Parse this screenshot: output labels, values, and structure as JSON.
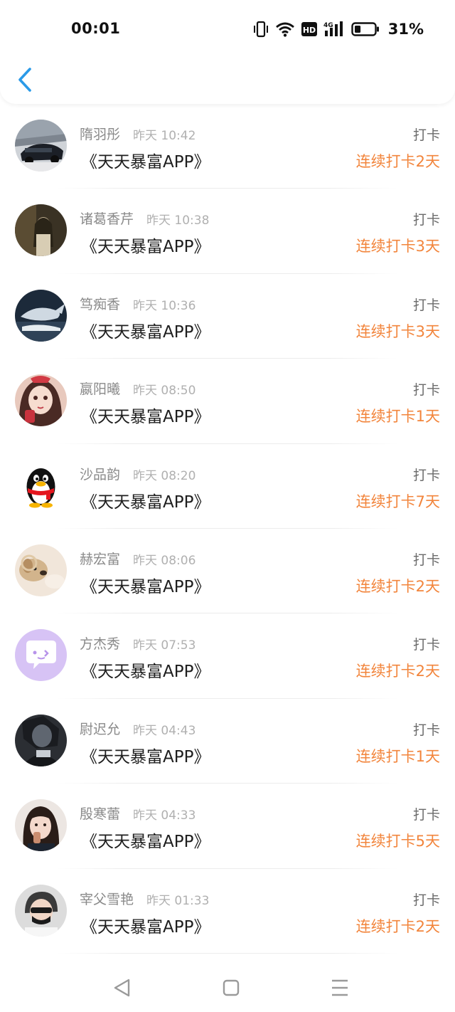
{
  "status_bar": {
    "time": "00:01",
    "battery_percent": "31%",
    "battery_level": 0.31,
    "network_label": "4G",
    "hd_label": "HD",
    "icons": [
      "vibrate-icon",
      "wifi-icon",
      "hd-icon",
      "signal-4g-icon",
      "battery-icon"
    ]
  },
  "header": {
    "back_icon": "chevron-left-icon"
  },
  "colors": {
    "accent_back": "#2a9ae8",
    "streak": "#f2853c",
    "name": "#8a8a8a",
    "time": "#b0b0b0"
  },
  "list": [
    {
      "name": "隋羽彤",
      "time": "昨天 10:42",
      "title": "《天天暴富APP》",
      "action": "打卡",
      "streak": "连续打卡2天",
      "avatar": "car-photo"
    },
    {
      "name": "诸葛香芹",
      "time": "昨天 10:38",
      "title": "《天天暴富APP》",
      "action": "打卡",
      "streak": "连续打卡3天",
      "avatar": "dark-girl-photo"
    },
    {
      "name": "笃痴香",
      "time": "昨天 10:36",
      "title": "《天天暴富APP》",
      "action": "打卡",
      "streak": "连续打卡3天",
      "avatar": "whale-photo"
    },
    {
      "name": "嬴阳曦",
      "time": "昨天 08:50",
      "title": "《天天暴富APP》",
      "action": "打卡",
      "streak": "连续打卡1天",
      "avatar": "anime-girl-photo"
    },
    {
      "name": "沙品韵",
      "time": "昨天 08:20",
      "title": "《天天暴富APP》",
      "action": "打卡",
      "streak": "连续打卡7天",
      "avatar": "penguin-avatar"
    },
    {
      "name": "赫宏富",
      "time": "昨天 08:06",
      "title": "《天天暴富APP》",
      "action": "打卡",
      "streak": "连续打卡2天",
      "avatar": "puppy-photo"
    },
    {
      "name": "方杰秀",
      "time": "昨天 07:53",
      "title": "《天天暴富APP》",
      "action": "打卡",
      "streak": "连续打卡2天",
      "avatar": "chat-bubble-avatar"
    },
    {
      "name": "尉迟允",
      "time": "昨天 04:43",
      "title": "《天天暴富APP》",
      "action": "打卡",
      "streak": "连续打卡1天",
      "avatar": "dark-man-photo"
    },
    {
      "name": "殷寒蕾",
      "time": "昨天 04:33",
      "title": "《天天暴富APP》",
      "action": "打卡",
      "streak": "连续打卡5天",
      "avatar": "girl-photo"
    },
    {
      "name": "宰父雪艳",
      "time": "昨天 01:33",
      "title": "《天天暴富APP》",
      "action": "打卡",
      "streak": "连续打卡2天",
      "avatar": "masked-man-photo"
    }
  ],
  "navbar": {
    "buttons": [
      "back-triangle-icon",
      "home-square-icon",
      "menu-lines-icon"
    ]
  }
}
